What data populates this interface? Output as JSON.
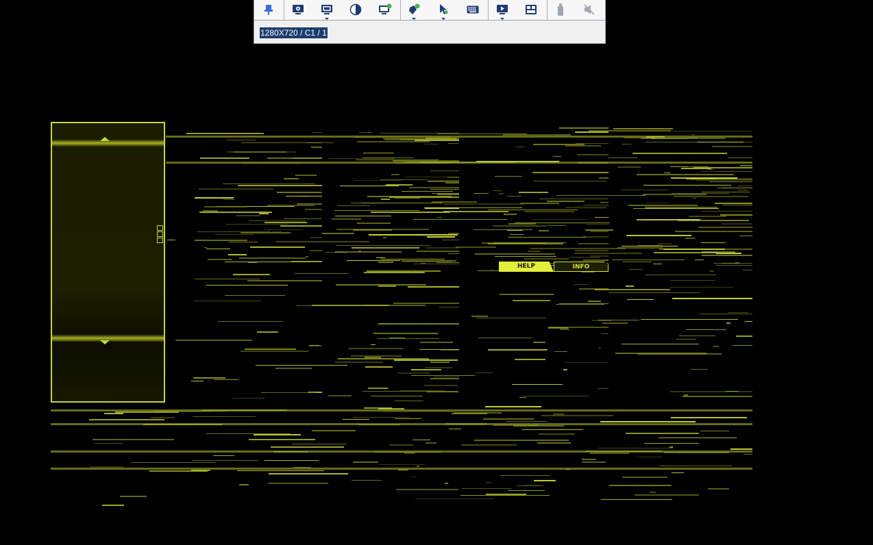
{
  "toolbar": {
    "buttons": [
      {
        "name": "pin-toolbar-icon",
        "title": "Pin toolbar",
        "has_menu": false,
        "color": "#3b6fd8"
      },
      {
        "name": "settings-icon",
        "title": "Settings",
        "has_menu": false,
        "color": "#1f3b73"
      },
      {
        "name": "display-icon",
        "title": "Display",
        "has_menu": true,
        "color": "#1f3b73"
      },
      {
        "name": "contrast-icon",
        "title": "Contrast",
        "has_menu": false,
        "color": "#1f3b73"
      },
      {
        "name": "monitor-refresh-icon",
        "title": "Refresh",
        "has_menu": false,
        "color": "#1f3b73"
      },
      {
        "name": "mouse-sync-icon",
        "title": "Mouse sync",
        "has_menu": true,
        "color": "#1f3b73"
      },
      {
        "name": "cursor-icon",
        "title": "Cursor",
        "has_menu": true,
        "color": "#1f3b73"
      },
      {
        "name": "keyboard-icon",
        "title": "Keyboard",
        "has_menu": false,
        "color": "#1f3b73"
      },
      {
        "name": "video-playback-icon",
        "title": "Video",
        "has_menu": true,
        "color": "#1f3b73"
      },
      {
        "name": "hotkeys-icon",
        "title": "Hotkeys",
        "has_menu": false,
        "color": "#1f3b73"
      },
      {
        "name": "usb-icon",
        "title": "USB media",
        "has_menu": false,
        "color": "#a0a8b4"
      },
      {
        "name": "audio-muted-icon",
        "title": "Audio",
        "has_menu": false,
        "color": "#a0a8b4"
      }
    ],
    "status_text": "1280X720 / C1 / 1"
  },
  "remote_screen": {
    "tabs": {
      "help": "HELP",
      "info": "INFO"
    },
    "accent_color": "#d9e63b"
  }
}
